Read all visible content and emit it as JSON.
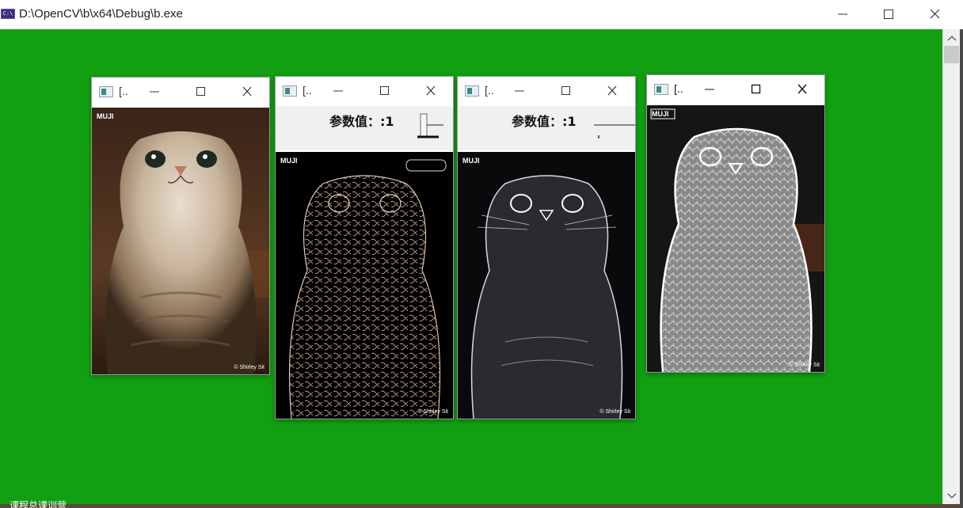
{
  "main_window": {
    "icon_text": "C:\\",
    "title": "D:\\OpenCV\\b\\x64\\Debug\\b.exe",
    "bottom_text": "课程总课训营"
  },
  "windows": [
    {
      "title": "[..",
      "has_trackbar": false,
      "watermark_tl": "MUJI",
      "watermark_br": "© Shirley Sit"
    },
    {
      "title": "[..",
      "has_trackbar": true,
      "param_label": "参数值：:1",
      "watermark_tl": "MUJI",
      "watermark_br": "© Shirley Sit"
    },
    {
      "title": "[..",
      "has_trackbar": true,
      "param_label": "参数值：:1",
      "watermark_tl": "MUJI",
      "watermark_br": "© Shirley Sit"
    },
    {
      "title": "[..",
      "has_trackbar": false,
      "watermark_tl": "MUJI",
      "watermark_br": "© Shirley Sit"
    }
  ],
  "colors": {
    "desktop_green": "#12a012",
    "toolbar_gray": "#f0f0f0"
  },
  "icons": [
    "console-icon",
    "minimize-icon",
    "maximize-icon",
    "close-icon",
    "window-icon",
    "scroll-up-icon",
    "scroll-down-icon"
  ]
}
